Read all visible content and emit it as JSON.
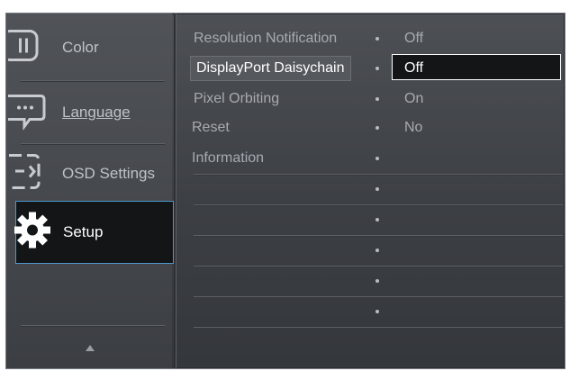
{
  "left_menu": {
    "categories": [
      {
        "label": "Color",
        "icon": "color-icon"
      },
      {
        "label": "Language",
        "icon": "language-icon"
      },
      {
        "label": "OSD Settings",
        "icon": "osd-settings-icon"
      },
      {
        "label": "Setup",
        "icon": "gear-icon",
        "selected": true
      }
    ],
    "scroll_up_icon": "up-arrow-icon"
  },
  "setup_menu": {
    "rows": [
      {
        "label": "Resolution Notification",
        "value": "Off"
      },
      {
        "label": "DisplayPort Daisychain",
        "value": "Off",
        "selected": true
      },
      {
        "label": "Pixel Orbiting",
        "value": "On"
      },
      {
        "label": "Reset",
        "value": "No"
      },
      {
        "label": "Information",
        "value": ""
      },
      {
        "label": "",
        "value": ""
      },
      {
        "label": "",
        "value": ""
      },
      {
        "label": "",
        "value": ""
      },
      {
        "label": "",
        "value": ""
      },
      {
        "label": "",
        "value": ""
      }
    ]
  },
  "colors": {
    "selection_border": "#4c97c9",
    "panel_background": "#44474c",
    "highlight_background": "#141517"
  }
}
